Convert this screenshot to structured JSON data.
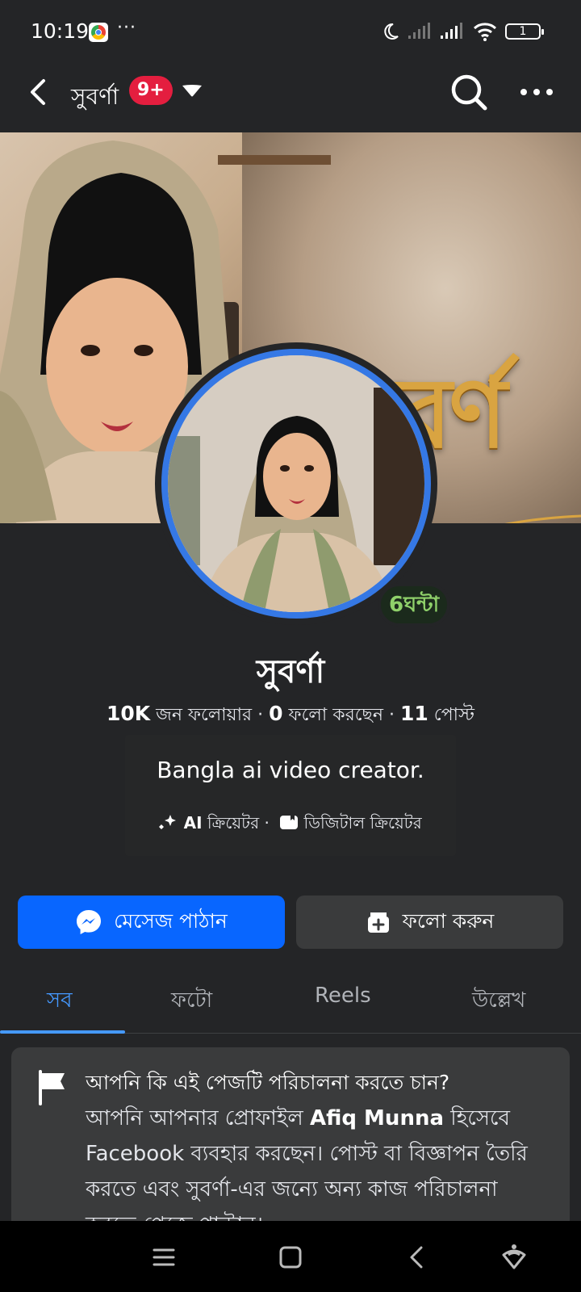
{
  "status_bar": {
    "time": "10:19",
    "more": "···",
    "battery": "1"
  },
  "top_bar": {
    "page_name": "সুবর্ণা",
    "notification_badge": "9+"
  },
  "cover": {
    "title_text": "সুবর্ণ"
  },
  "avatar": {
    "story_time": "6ঘন্টা"
  },
  "profile": {
    "name": "সুবর্ণা",
    "followers_count": "10K",
    "followers_label": "জন ফলোয়ার",
    "following_count": "0",
    "following_label": "ফলো করছেন",
    "posts_count": "11",
    "posts_label": "পোস্ট",
    "separator": "·",
    "bio": "Bangla ai video creator.",
    "category_ai_prefix": "AI",
    "category_ai_label": "ক্রিয়েটর",
    "category_digital": "ডিজিটাল ক্রিয়েটর"
  },
  "actions": {
    "message_label": "মেসেজ পাঠান",
    "follow_label": "ফলো করুন"
  },
  "tabs": [
    {
      "label": "সব",
      "active": true
    },
    {
      "label": "ফটো",
      "active": false
    },
    {
      "label": "Reels",
      "active": false
    },
    {
      "label": "উল্লেখ",
      "active": false
    }
  ],
  "notice": {
    "title": "আপনি কি এই পেজটি পরিচালনা করতে চান?",
    "body_prefix": "আপনি আপনার প্রোফাইল",
    "profile_name": "Afiq Munna",
    "body_suffix": "হিসেবে Facebook ব্যবহার করছেন। পোস্ট বা বিজ্ঞাপন তৈরি করতে এবং সুবর্ণা-এর জন্যে অন্য কাজ পরিচালনা করতে পেজে পাল্টান।"
  },
  "colors": {
    "background": "#242527",
    "primary_button": "#0866ff",
    "secondary_button": "#3a3b3c",
    "active_tab": "#4599ff",
    "badge": "#e41e3f",
    "avatar_ring": "#3578e5"
  },
  "icons": [
    "chrome-icon",
    "moon-icon",
    "signal-icon",
    "wifi-icon",
    "battery-icon",
    "back-icon",
    "caret-down-icon",
    "search-icon",
    "more-icon",
    "messenger-icon",
    "follow-icon",
    "sparkle-icon",
    "digital-creator-icon",
    "flag-icon",
    "menu-icon",
    "home-icon",
    "back-nav-icon",
    "assistant-icon"
  ]
}
